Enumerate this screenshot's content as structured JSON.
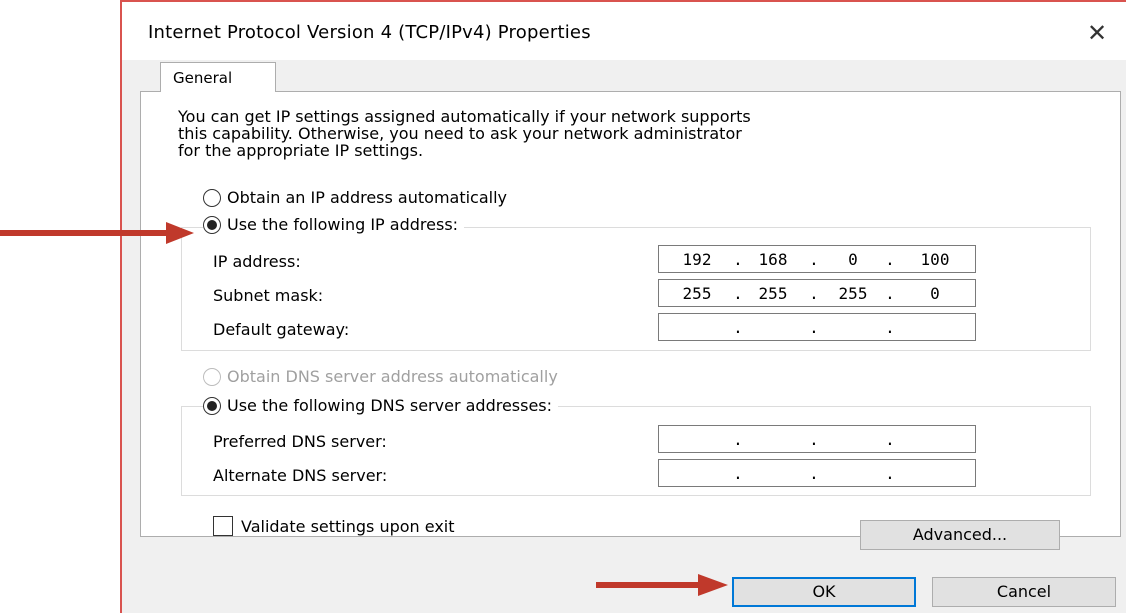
{
  "window": {
    "title": "Internet Protocol Version 4 (TCP/IPv4) Properties",
    "close_glyph": "✕"
  },
  "tabs": [
    {
      "label": "General"
    }
  ],
  "intro_text": "You can get IP settings assigned automatically if your network supports\nthis capability. Otherwise, you need to ask your network administrator\nfor the appropriate IP settings.",
  "ip_section": {
    "auto_label": "Obtain an IP address automatically",
    "manual_label": "Use the following IP address:",
    "selected": "manual",
    "fields": [
      {
        "label": "IP address:",
        "octets": [
          "192",
          "168",
          "0",
          "100"
        ]
      },
      {
        "label": "Subnet mask:",
        "octets": [
          "255",
          "255",
          "255",
          "0"
        ]
      },
      {
        "label": "Default gateway:",
        "octets": [
          "",
          "",
          "",
          ""
        ]
      }
    ]
  },
  "dns_section": {
    "auto_label": "Obtain DNS server address automatically",
    "manual_label": "Use the following DNS server addresses:",
    "selected": "manual",
    "fields": [
      {
        "label": "Preferred DNS server:",
        "octets": [
          "",
          "",
          "",
          ""
        ]
      },
      {
        "label": "Alternate DNS server:",
        "octets": [
          "",
          "",
          "",
          ""
        ]
      }
    ]
  },
  "validate": {
    "label": "Validate settings upon exit",
    "checked": false
  },
  "buttons": {
    "advanced": "Advanced...",
    "ok": "OK",
    "cancel": "Cancel"
  },
  "colors": {
    "arrow": "#c0392b",
    "accent": "#0078d7",
    "window_border": "#d9534f"
  }
}
